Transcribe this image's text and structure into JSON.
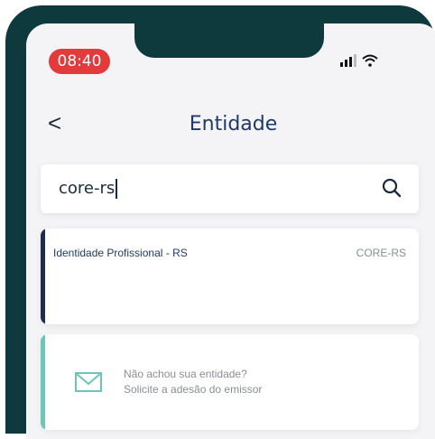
{
  "status_bar": {
    "time": "08:40",
    "colors": {
      "time_pill": "#e23b3b"
    }
  },
  "header": {
    "back_label": "<",
    "title": "Entidade"
  },
  "search": {
    "value": "core-rs",
    "icon": "search-icon"
  },
  "results": [
    {
      "label": "Identidade Profissional - RS",
      "code": "CORE-RS"
    }
  ],
  "request": {
    "icon": "mail-icon",
    "line1": "Não achou sua entidade?",
    "line2": "Solicite a adesão do emissor"
  },
  "colors": {
    "frame": "#0f3a3d",
    "title": "#1f3a66",
    "result_accent": "#1f2d4a",
    "request_accent": "#6cc5b6"
  }
}
